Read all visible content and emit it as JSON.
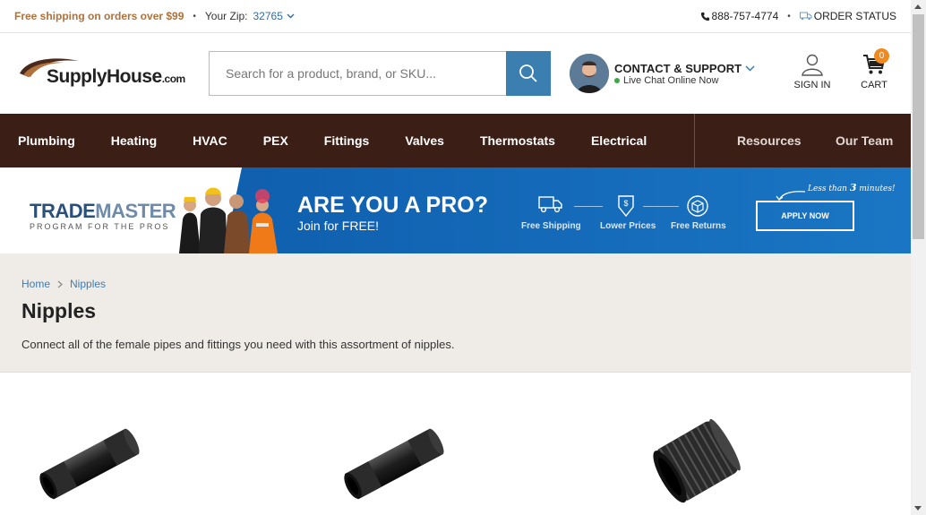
{
  "topbar": {
    "shipping_text": "Free shipping on orders over $99",
    "zip_label": "Your Zip:",
    "zip_value": "32765",
    "phone": "888-757-4774",
    "order_status": "ORDER STATUS"
  },
  "header": {
    "logo_text": "SupplyHouse",
    "logo_suffix": ".com",
    "search_placeholder": "Search for a product, brand, or SKU...",
    "contact_title": "CONTACT & SUPPORT",
    "contact_sub": "Live Chat Online Now",
    "signin_label": "SIGN IN",
    "cart_label": "CART",
    "cart_count": "0"
  },
  "nav": {
    "items": [
      "Plumbing",
      "Heating",
      "HVAC",
      "PEX",
      "Fittings",
      "Valves",
      "Thermostats",
      "Electrical"
    ],
    "resources": "Resources",
    "team": "Our Team"
  },
  "banner": {
    "logo_main": "TRADE",
    "logo_main2": "MASTER",
    "logo_sub": "PROGRAM FOR THE PROS",
    "title": "ARE YOU A PRO?",
    "subtitle": "Join for FREE!",
    "features": [
      "Free Shipping",
      "Lower Prices",
      "Free Returns"
    ],
    "apply": "APPLY NOW",
    "less_than": "Less than",
    "less_num": "3",
    "less_unit": "minutes!"
  },
  "category": {
    "breadcrumb_home": "Home",
    "breadcrumb_current": "Nipples",
    "title": "Nipples",
    "description": "Connect all of the female pipes and fittings you need with this assortment of nipples."
  },
  "colors": {
    "nav_bg": "#3b1f16",
    "accent_blue": "#3a7fb0",
    "shipping_orange": "#b0713c",
    "badge_orange": "#f08a1c"
  }
}
